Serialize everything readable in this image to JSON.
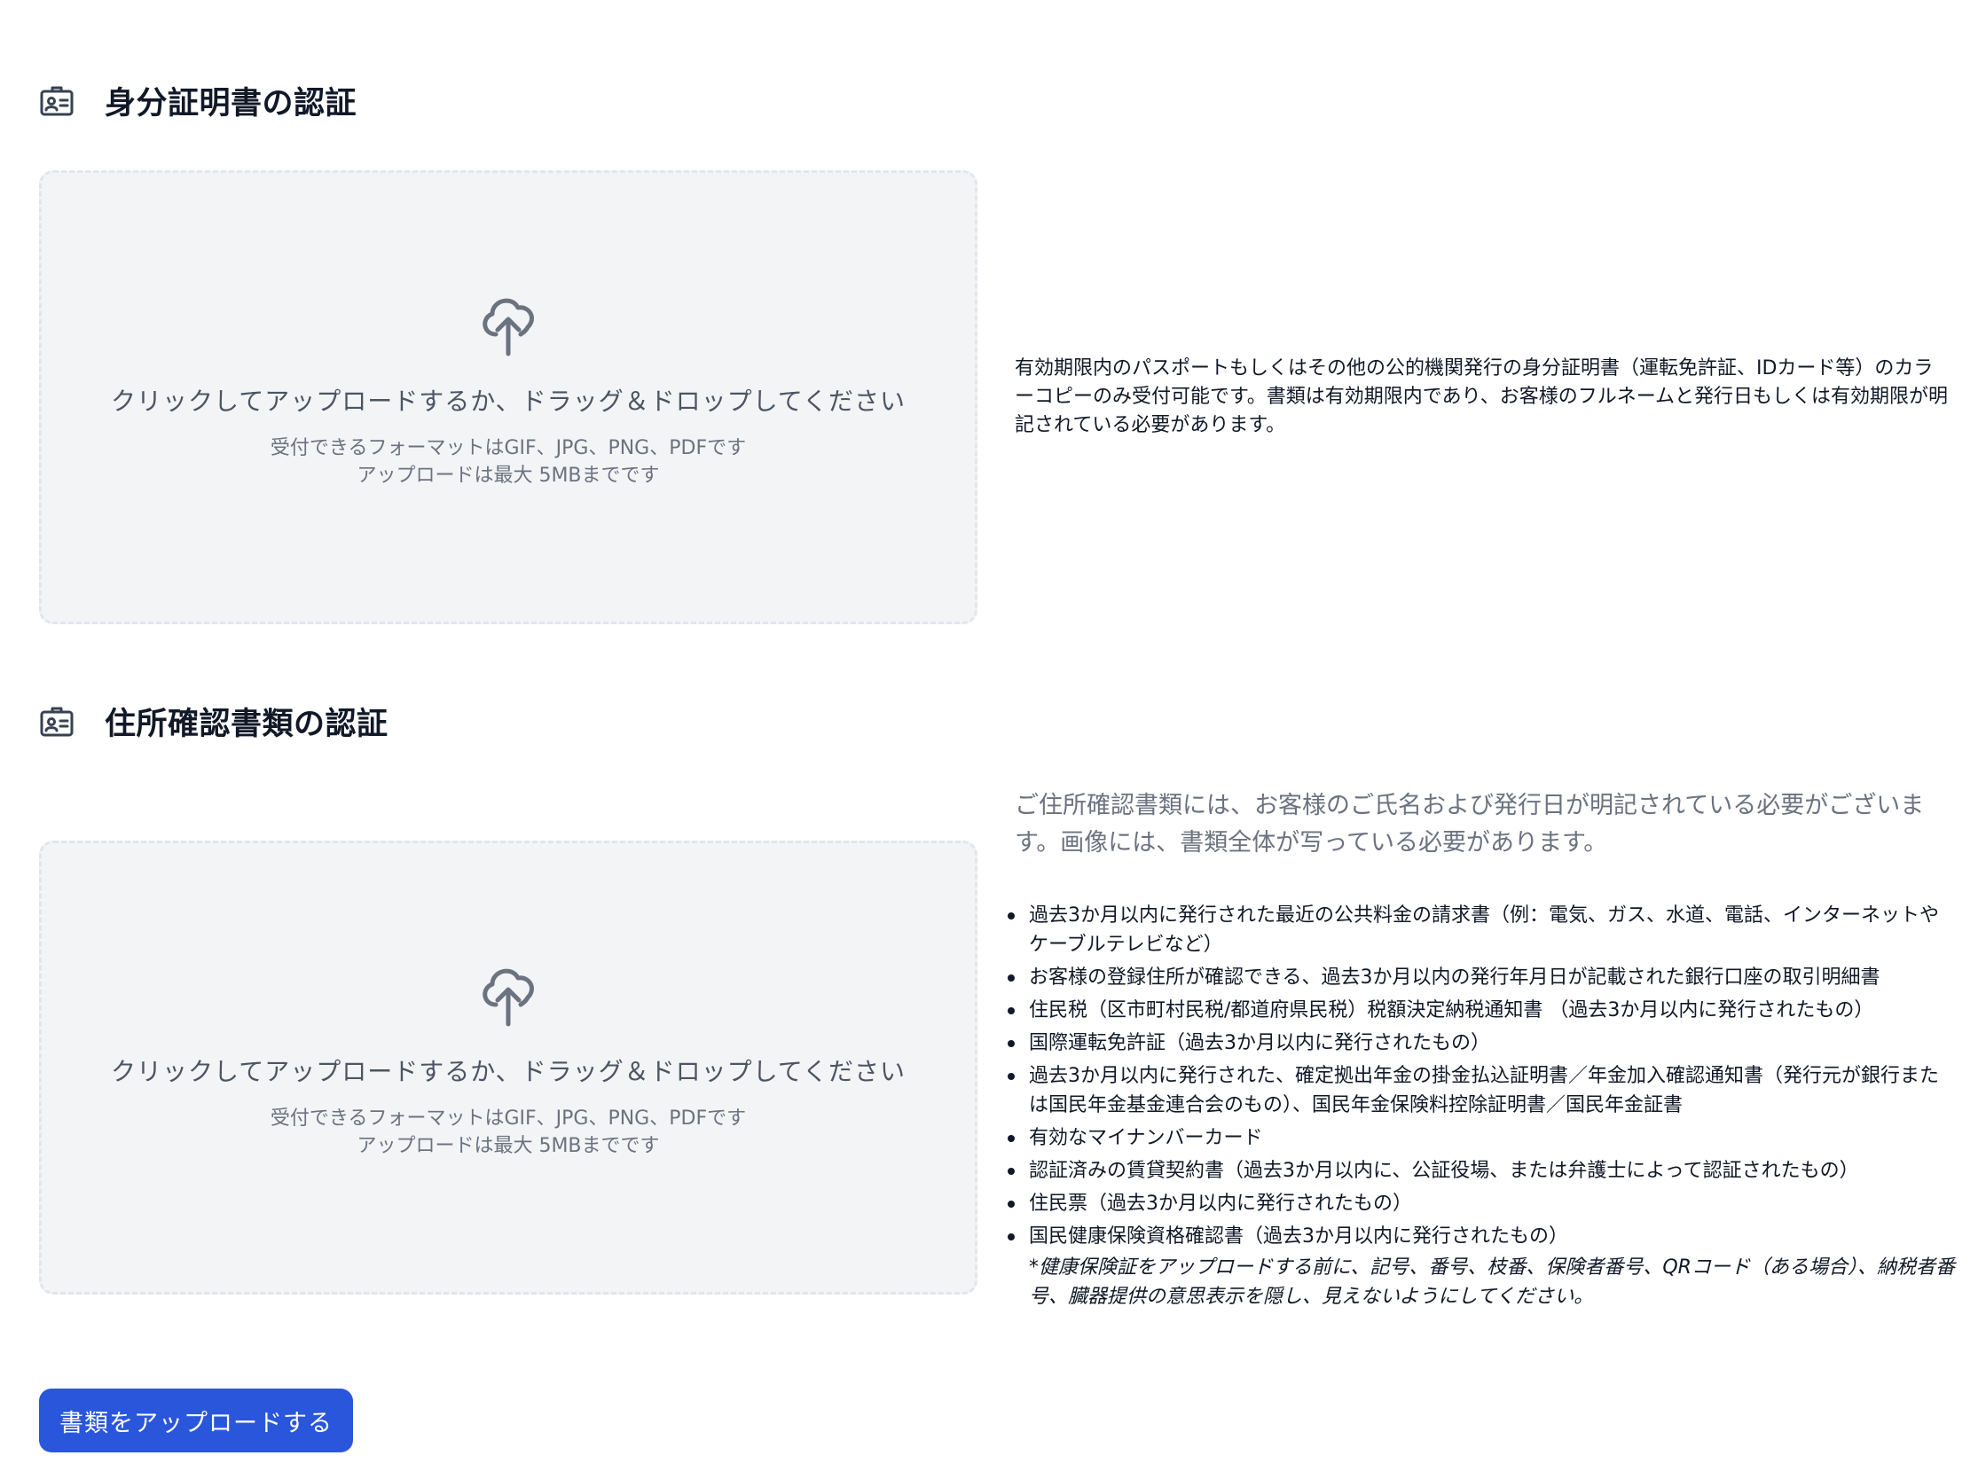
{
  "id_section": {
    "title": "身分証明書の認証",
    "dropzone": {
      "main": "クリックしてアップロードするか、ドラッグ＆ドロップしてください",
      "formats": "受付できるフォーマットはGIF、JPG、PNG、PDFです",
      "max_size": "アップロードは最大 5MBまでです"
    },
    "description": "有効期限内のパスポートもしくはその他の公的機関発行の身分証明書（運転免許証、IDカード等）のカラーコピーのみ受付可能です。書類は有効期限内であり、お客様のフルネームと発行日もしくは有効期限が明記されている必要があります。"
  },
  "address_section": {
    "title": "住所確認書類の認証",
    "dropzone": {
      "main": "クリックしてアップロードするか、ドラッグ＆ドロップしてください",
      "formats": "受付できるフォーマットはGIF、JPG、PNG、PDFです",
      "max_size": "アップロードは最大 5MBまでです"
    },
    "description": "ご住所確認書類には、お客様のご氏名および発行日が明記されている必要がございます。画像には、書類全体が写っている必要があります。",
    "documents": [
      "過去3か月以内に発行された最近の公共料金の請求書（例：電気、ガス、水道、電話、インターネットやケーブルテレビなど）",
      "お客様の登録住所が確認できる、過去3か月以内の発行年月日が記載された銀行口座の取引明細書",
      "住民税（区市町村民税/都道府県民税）税額決定納税通知書 （過去3か月以内に発行されたもの）",
      "国際運転免許証（過去3か月以内に発行されたもの）",
      "過去3か月以内に発行された、確定拠出年金の掛金払込証明書／年金加入確認通知書（発行元が銀行または国民年金基金連合会のもの）、国民年金保険料控除証明書／国民年金証書",
      "有効なマイナンバーカード",
      "認証済みの賃貸契約書（過去3か月以内に、公証役場、または弁護士によって認証されたもの）",
      "住民票（過去3か月以内に発行されたもの）",
      "国民健康保険資格確認書（過去3か月以内に発行されたもの）"
    ],
    "note": "*健康保険証をアップロードする前に、記号、番号、枝番、保険者番号、QRコード（ある場合）、納税者番号、臓器提供の意思表示を隠し、見えないようにしてください。"
  },
  "submit_label": "書類をアップロードする",
  "colors": {
    "primary": "#2a56db",
    "dropzone_bg": "#f3f4f6",
    "muted_text": "#6b7280"
  }
}
